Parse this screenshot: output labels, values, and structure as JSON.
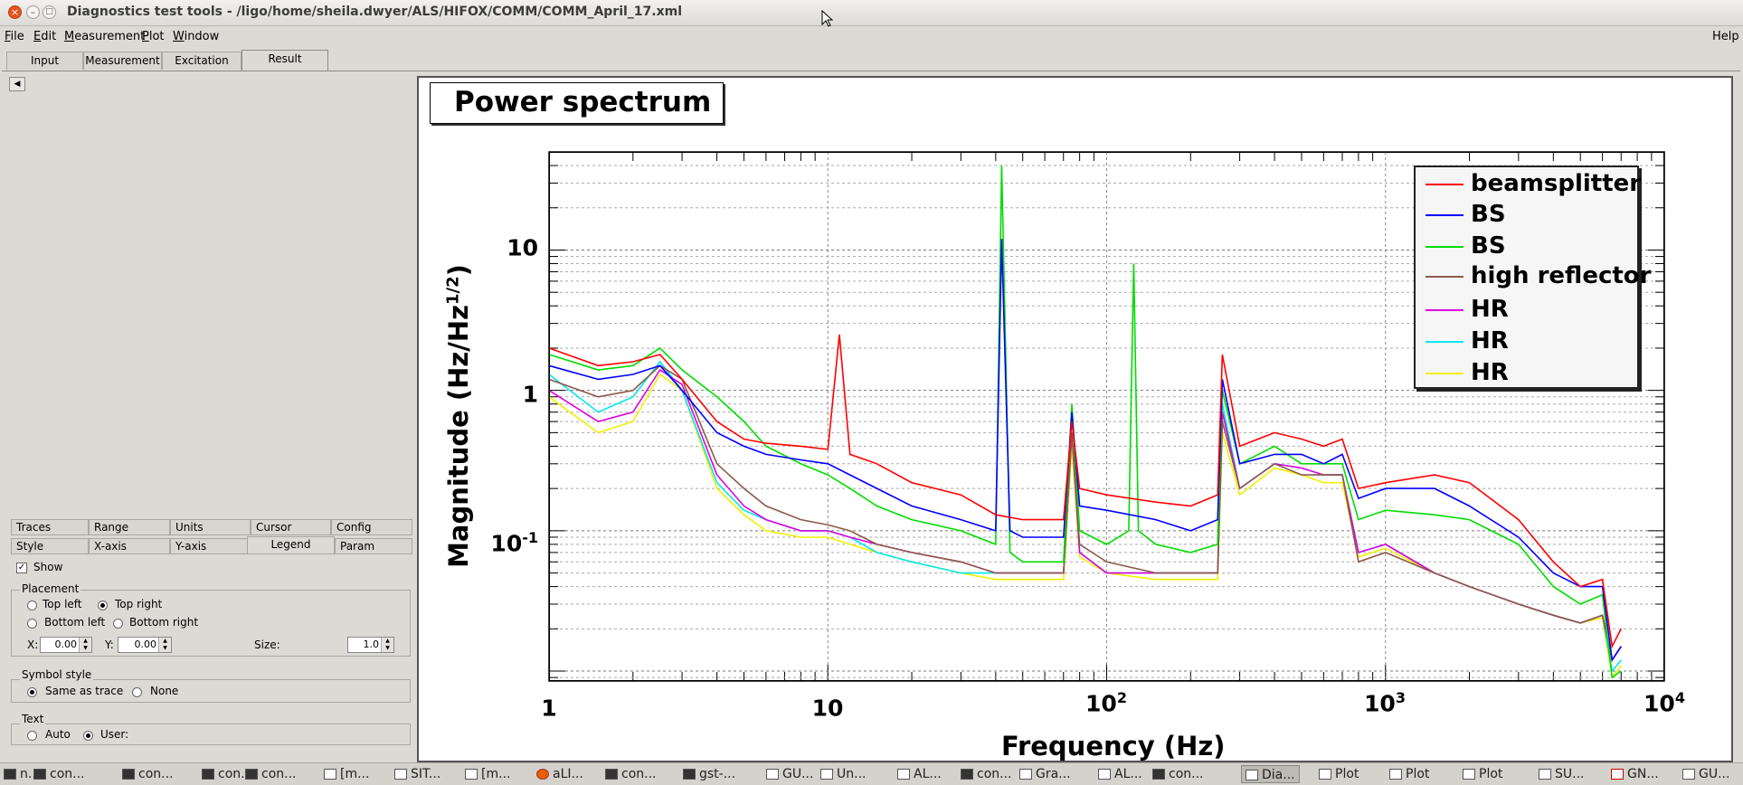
{
  "window": {
    "title": "Diagnostics test tools - /ligo/home/sheila.dwyer/ALS/HIFOX/COMM/COMM_April_17.xml",
    "close_glyph": "×",
    "min_glyph": "–",
    "max_glyph": "□"
  },
  "menubar": {
    "file": {
      "m": "F",
      "rest": "ile"
    },
    "edit": {
      "m": "E",
      "rest": "dit"
    },
    "measurement": {
      "m": "M",
      "rest": "easurement"
    },
    "plot": {
      "m": "P",
      "rest": "lot"
    },
    "window": {
      "m": "W",
      "rest": "indow"
    },
    "help": "Help"
  },
  "main_tabs": [
    "Input",
    "Measurement",
    "Excitation",
    "Result"
  ],
  "left": {
    "arrow": "◀",
    "subtabs_row1": [
      "Traces",
      "Range",
      "Units",
      "Cursor",
      "Config"
    ],
    "subtabs_row2": [
      "Style",
      "X-axis",
      "Y-axis",
      "Legend",
      "Param"
    ],
    "show_label": "Show",
    "show_check": "✓",
    "placement": {
      "title": "Placement",
      "top_left": "Top left",
      "top_right": "Top right",
      "bottom_left": "Bottom left",
      "bottom_right": "Bottom right",
      "x_label": "X:",
      "x_value": "0.00",
      "y_label": "Y:",
      "y_value": "0.00",
      "size_label": "Size:",
      "size_value": "1.0"
    },
    "symbol_style": {
      "title": "Symbol style",
      "same": "Same as trace",
      "none": "None"
    },
    "text": {
      "title": "Text",
      "auto": "Auto",
      "user": "User:"
    }
  },
  "plot": {
    "title": "Power spectrum",
    "ylabel_main": "Magnitude (Hz/Hz",
    "ylabel_sup": "1/2",
    "ylabel_end": ")",
    "xlabel": "Frequency (Hz)",
    "yticks": [
      {
        "base": "10",
        "exp": ""
      },
      {
        "base": "1",
        "exp": ""
      },
      {
        "base": "10",
        "exp": "-1"
      }
    ],
    "xticks": [
      {
        "base": "1",
        "exp": ""
      },
      {
        "base": "10",
        "exp": ""
      },
      {
        "base": "10",
        "exp": "2"
      },
      {
        "base": "10",
        "exp": "3"
      },
      {
        "base": "10",
        "exp": "4"
      }
    ],
    "legend": [
      {
        "label": "beamsplitter",
        "color": "#ff0000"
      },
      {
        "label": "BS",
        "color": "#0000ff"
      },
      {
        "label": "BS",
        "color": "#00dd00"
      },
      {
        "label": "high reflector",
        "color": "#8b5a4a"
      },
      {
        "label": "HR",
        "color": "#e000e0"
      },
      {
        "label": "HR",
        "color": "#00e8f0"
      },
      {
        "label": "HR",
        "color": "#f0f000"
      }
    ]
  },
  "chart_data": {
    "type": "line",
    "title": "Power spectrum",
    "xlabel": "Frequency (Hz)",
    "ylabel": "Magnitude (Hz/Hz^1/2)",
    "xscale": "log",
    "yscale": "log",
    "xlim": [
      1,
      10000
    ],
    "ylim": [
      0.0085,
      50
    ],
    "grid": true,
    "legend_position": "top-right",
    "series": [
      {
        "name": "beamsplitter",
        "color": "#ff0000",
        "x": [
          1,
          1.5,
          2,
          2.5,
          3,
          4,
          5,
          6,
          8,
          10,
          11,
          12,
          15,
          20,
          30,
          40,
          50,
          60,
          70,
          75,
          80,
          100,
          150,
          200,
          250,
          260,
          300,
          400,
          500,
          600,
          700,
          800,
          1000,
          1500,
          2000,
          3000,
          4000,
          5000,
          6000,
          6500,
          7000
        ],
        "y": [
          2.0,
          1.5,
          1.6,
          1.8,
          1.2,
          0.6,
          0.45,
          0.42,
          0.4,
          0.38,
          2.5,
          0.35,
          0.3,
          0.22,
          0.18,
          0.13,
          0.12,
          0.12,
          0.12,
          0.6,
          0.2,
          0.18,
          0.16,
          0.15,
          0.18,
          1.8,
          0.4,
          0.5,
          0.45,
          0.4,
          0.45,
          0.2,
          0.22,
          0.25,
          0.22,
          0.12,
          0.06,
          0.04,
          0.045,
          0.015,
          0.02
        ]
      },
      {
        "name": "BS",
        "color": "#0000ff",
        "x": [
          1,
          1.5,
          2,
          2.5,
          3,
          4,
          5,
          6,
          8,
          10,
          12,
          15,
          20,
          30,
          40,
          42,
          45,
          50,
          60,
          70,
          75,
          80,
          100,
          150,
          200,
          250,
          260,
          300,
          400,
          500,
          600,
          700,
          800,
          1000,
          1500,
          2000,
          3000,
          4000,
          5000,
          6000,
          6500,
          7000
        ],
        "y": [
          1.5,
          1.2,
          1.3,
          1.5,
          1.0,
          0.5,
          0.4,
          0.35,
          0.32,
          0.3,
          0.25,
          0.2,
          0.15,
          0.12,
          0.1,
          12,
          0.1,
          0.09,
          0.09,
          0.09,
          0.7,
          0.15,
          0.14,
          0.12,
          0.1,
          0.12,
          1.2,
          0.3,
          0.35,
          0.35,
          0.3,
          0.35,
          0.17,
          0.2,
          0.2,
          0.15,
          0.09,
          0.05,
          0.04,
          0.04,
          0.012,
          0.015
        ]
      },
      {
        "name": "BS",
        "color": "#00dd00",
        "x": [
          1,
          1.5,
          2,
          2.5,
          3,
          4,
          5,
          6,
          8,
          10,
          12,
          15,
          20,
          30,
          40,
          42,
          45,
          50,
          60,
          70,
          75,
          80,
          100,
          120,
          125,
          130,
          150,
          200,
          250,
          260,
          300,
          400,
          500,
          600,
          700,
          800,
          1000,
          1500,
          2000,
          3000,
          4000,
          5000,
          6000,
          6500,
          7000
        ],
        "y": [
          1.8,
          1.4,
          1.5,
          2.0,
          1.4,
          0.9,
          0.6,
          0.4,
          0.3,
          0.25,
          0.2,
          0.15,
          0.12,
          0.1,
          0.08,
          40,
          0.07,
          0.06,
          0.06,
          0.06,
          0.8,
          0.1,
          0.08,
          0.1,
          8,
          0.1,
          0.08,
          0.07,
          0.08,
          1.0,
          0.3,
          0.4,
          0.3,
          0.3,
          0.3,
          0.12,
          0.14,
          0.13,
          0.12,
          0.08,
          0.04,
          0.03,
          0.035,
          0.009,
          0.01
        ]
      },
      {
        "name": "high reflector",
        "color": "#8b5a4a",
        "x": [
          1,
          1.5,
          2,
          2.5,
          3,
          4,
          5,
          6,
          8,
          10,
          12,
          15,
          20,
          30,
          40,
          50,
          60,
          70,
          75,
          80,
          100,
          150,
          200,
          250,
          260,
          300,
          400,
          500,
          600,
          700,
          800,
          1000,
          1500,
          2000,
          3000,
          4000,
          5000,
          6000,
          6500,
          7000
        ],
        "y": [
          1.2,
          0.9,
          1.0,
          1.5,
          1.2,
          0.3,
          0.2,
          0.15,
          0.12,
          0.11,
          0.1,
          0.08,
          0.07,
          0.06,
          0.05,
          0.05,
          0.05,
          0.05,
          0.5,
          0.08,
          0.06,
          0.05,
          0.05,
          0.05,
          0.6,
          0.2,
          0.3,
          0.25,
          0.25,
          0.25,
          0.06,
          0.07,
          0.05,
          0.04,
          0.03,
          0.025,
          0.022,
          0.025,
          0.012,
          0.015
        ]
      },
      {
        "name": "HR",
        "color": "#e000e0",
        "x": [
          1,
          1.5,
          2,
          2.5,
          3,
          4,
          5,
          6,
          8,
          10,
          12,
          15,
          20,
          30,
          40,
          50,
          60,
          70,
          75,
          80,
          100,
          150,
          200,
          250,
          260,
          300,
          400,
          500,
          600,
          700,
          800,
          1000,
          1500,
          2000,
          3000,
          4000,
          5000,
          6000,
          6500,
          7000
        ],
        "y": [
          1.0,
          0.6,
          0.7,
          1.4,
          1.1,
          0.25,
          0.15,
          0.12,
          0.1,
          0.1,
          0.09,
          0.08,
          0.07,
          0.06,
          0.05,
          0.05,
          0.05,
          0.05,
          0.5,
          0.07,
          0.05,
          0.05,
          0.05,
          0.05,
          0.7,
          0.2,
          0.3,
          0.28,
          0.25,
          0.25,
          0.07,
          0.08,
          0.05,
          0.04,
          0.03,
          0.025,
          0.022,
          0.025,
          0.012,
          0.015
        ]
      },
      {
        "name": "HR",
        "color": "#00e8f0",
        "x": [
          1,
          1.5,
          2,
          2.5,
          3,
          4,
          5,
          6,
          8,
          10,
          12,
          15,
          20,
          30,
          40,
          50,
          60,
          70,
          75,
          80,
          100,
          150,
          200,
          250,
          260,
          300,
          400,
          500,
          600,
          700,
          800,
          1000,
          1500,
          2000,
          3000,
          4000,
          5000,
          6000,
          6500,
          7000
        ],
        "y": [
          1.3,
          0.7,
          0.9,
          1.6,
          1.0,
          0.22,
          0.14,
          0.12,
          0.1,
          0.1,
          0.09,
          0.07,
          0.06,
          0.05,
          0.05,
          0.05,
          0.05,
          0.05,
          0.5,
          0.07,
          0.05,
          0.05,
          0.05,
          0.05,
          0.8,
          0.2,
          0.3,
          0.28,
          0.25,
          0.25,
          0.07,
          0.08,
          0.05,
          0.04,
          0.03,
          0.025,
          0.022,
          0.025,
          0.01,
          0.012
        ]
      },
      {
        "name": "HR",
        "color": "#f0f000",
        "x": [
          1,
          1.5,
          2,
          2.5,
          3,
          4,
          5,
          6,
          8,
          10,
          12,
          15,
          20,
          30,
          40,
          50,
          60,
          70,
          75,
          80,
          100,
          150,
          200,
          250,
          260,
          300,
          400,
          500,
          600,
          700,
          800,
          1000,
          1500,
          2000,
          3000,
          4000,
          5000,
          6000,
          6500,
          7000
        ],
        "y": [
          0.9,
          0.5,
          0.6,
          1.3,
          1.0,
          0.2,
          0.13,
          0.1,
          0.09,
          0.09,
          0.08,
          0.07,
          0.06,
          0.05,
          0.045,
          0.045,
          0.045,
          0.045,
          0.4,
          0.065,
          0.05,
          0.045,
          0.045,
          0.045,
          0.5,
          0.18,
          0.28,
          0.25,
          0.22,
          0.22,
          0.065,
          0.075,
          0.05,
          0.04,
          0.03,
          0.025,
          0.022,
          0.024,
          0.009,
          0.011
        ]
      }
    ]
  },
  "taskbar": [
    {
      "label": "n...",
      "icon": "term"
    },
    {
      "label": "con...",
      "icon": "term"
    },
    {
      "label": "con...",
      "icon": "term"
    },
    {
      "label": "con...",
      "icon": "term"
    },
    {
      "label": "con...",
      "icon": "term"
    },
    {
      "label": "[m...",
      "icon": "win"
    },
    {
      "label": "SIT...",
      "icon": "win"
    },
    {
      "label": "[m...",
      "icon": "win"
    },
    {
      "label": "aLI...",
      "icon": "ff"
    },
    {
      "label": "con...",
      "icon": "term"
    },
    {
      "label": "gst-...",
      "icon": "term"
    },
    {
      "label": "GU...",
      "icon": "win"
    },
    {
      "label": "Un...",
      "icon": "win"
    },
    {
      "label": "AL...",
      "icon": "win"
    },
    {
      "label": "con...",
      "icon": "term"
    },
    {
      "label": "Gra...",
      "icon": "win"
    },
    {
      "label": "AL...",
      "icon": "win"
    },
    {
      "label": "con...",
      "icon": "term"
    },
    {
      "label": "Dia...",
      "icon": "win",
      "active": true
    },
    {
      "label": "Plot",
      "icon": "win"
    },
    {
      "label": "Plot",
      "icon": "win"
    },
    {
      "label": "Plot",
      "icon": "win"
    },
    {
      "label": "SU...",
      "icon": "win"
    },
    {
      "label": "GN...",
      "icon": "pdf"
    },
    {
      "label": "GU...",
      "icon": "win"
    }
  ]
}
